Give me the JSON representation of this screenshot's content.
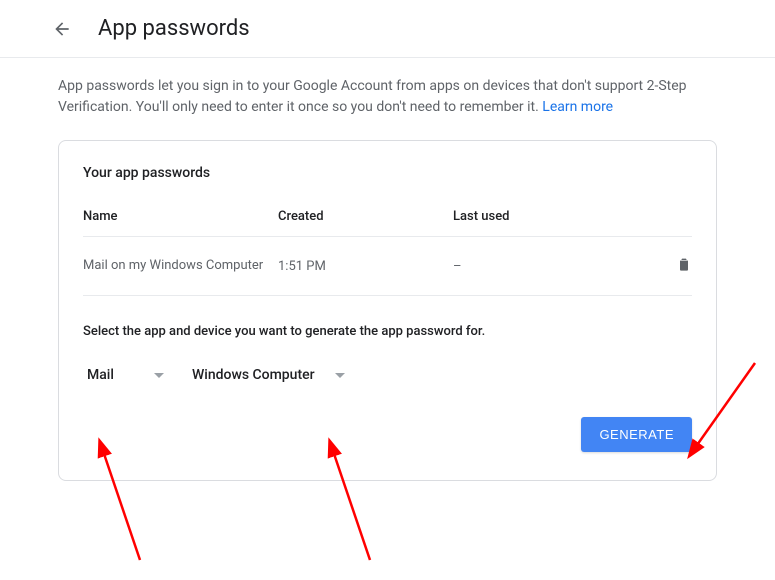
{
  "header": {
    "title": "App passwords"
  },
  "description": {
    "text": "App passwords let you sign in to your Google Account from apps on devices that don't support 2-Step Verification. You'll only need to enter it once so you don't need to remember it. ",
    "learn_more": "Learn more"
  },
  "card": {
    "title": "Your app passwords",
    "columns": {
      "name": "Name",
      "created": "Created",
      "lastused": "Last used"
    },
    "rows": [
      {
        "name": "Mail on my Windows Computer",
        "created": "1:51 PM",
        "lastused": "–"
      }
    ],
    "instruction": "Select the app and device you want to generate the app password for.",
    "select_app": "Mail",
    "select_device": "Windows Computer",
    "generate_label": "GENERATE"
  }
}
